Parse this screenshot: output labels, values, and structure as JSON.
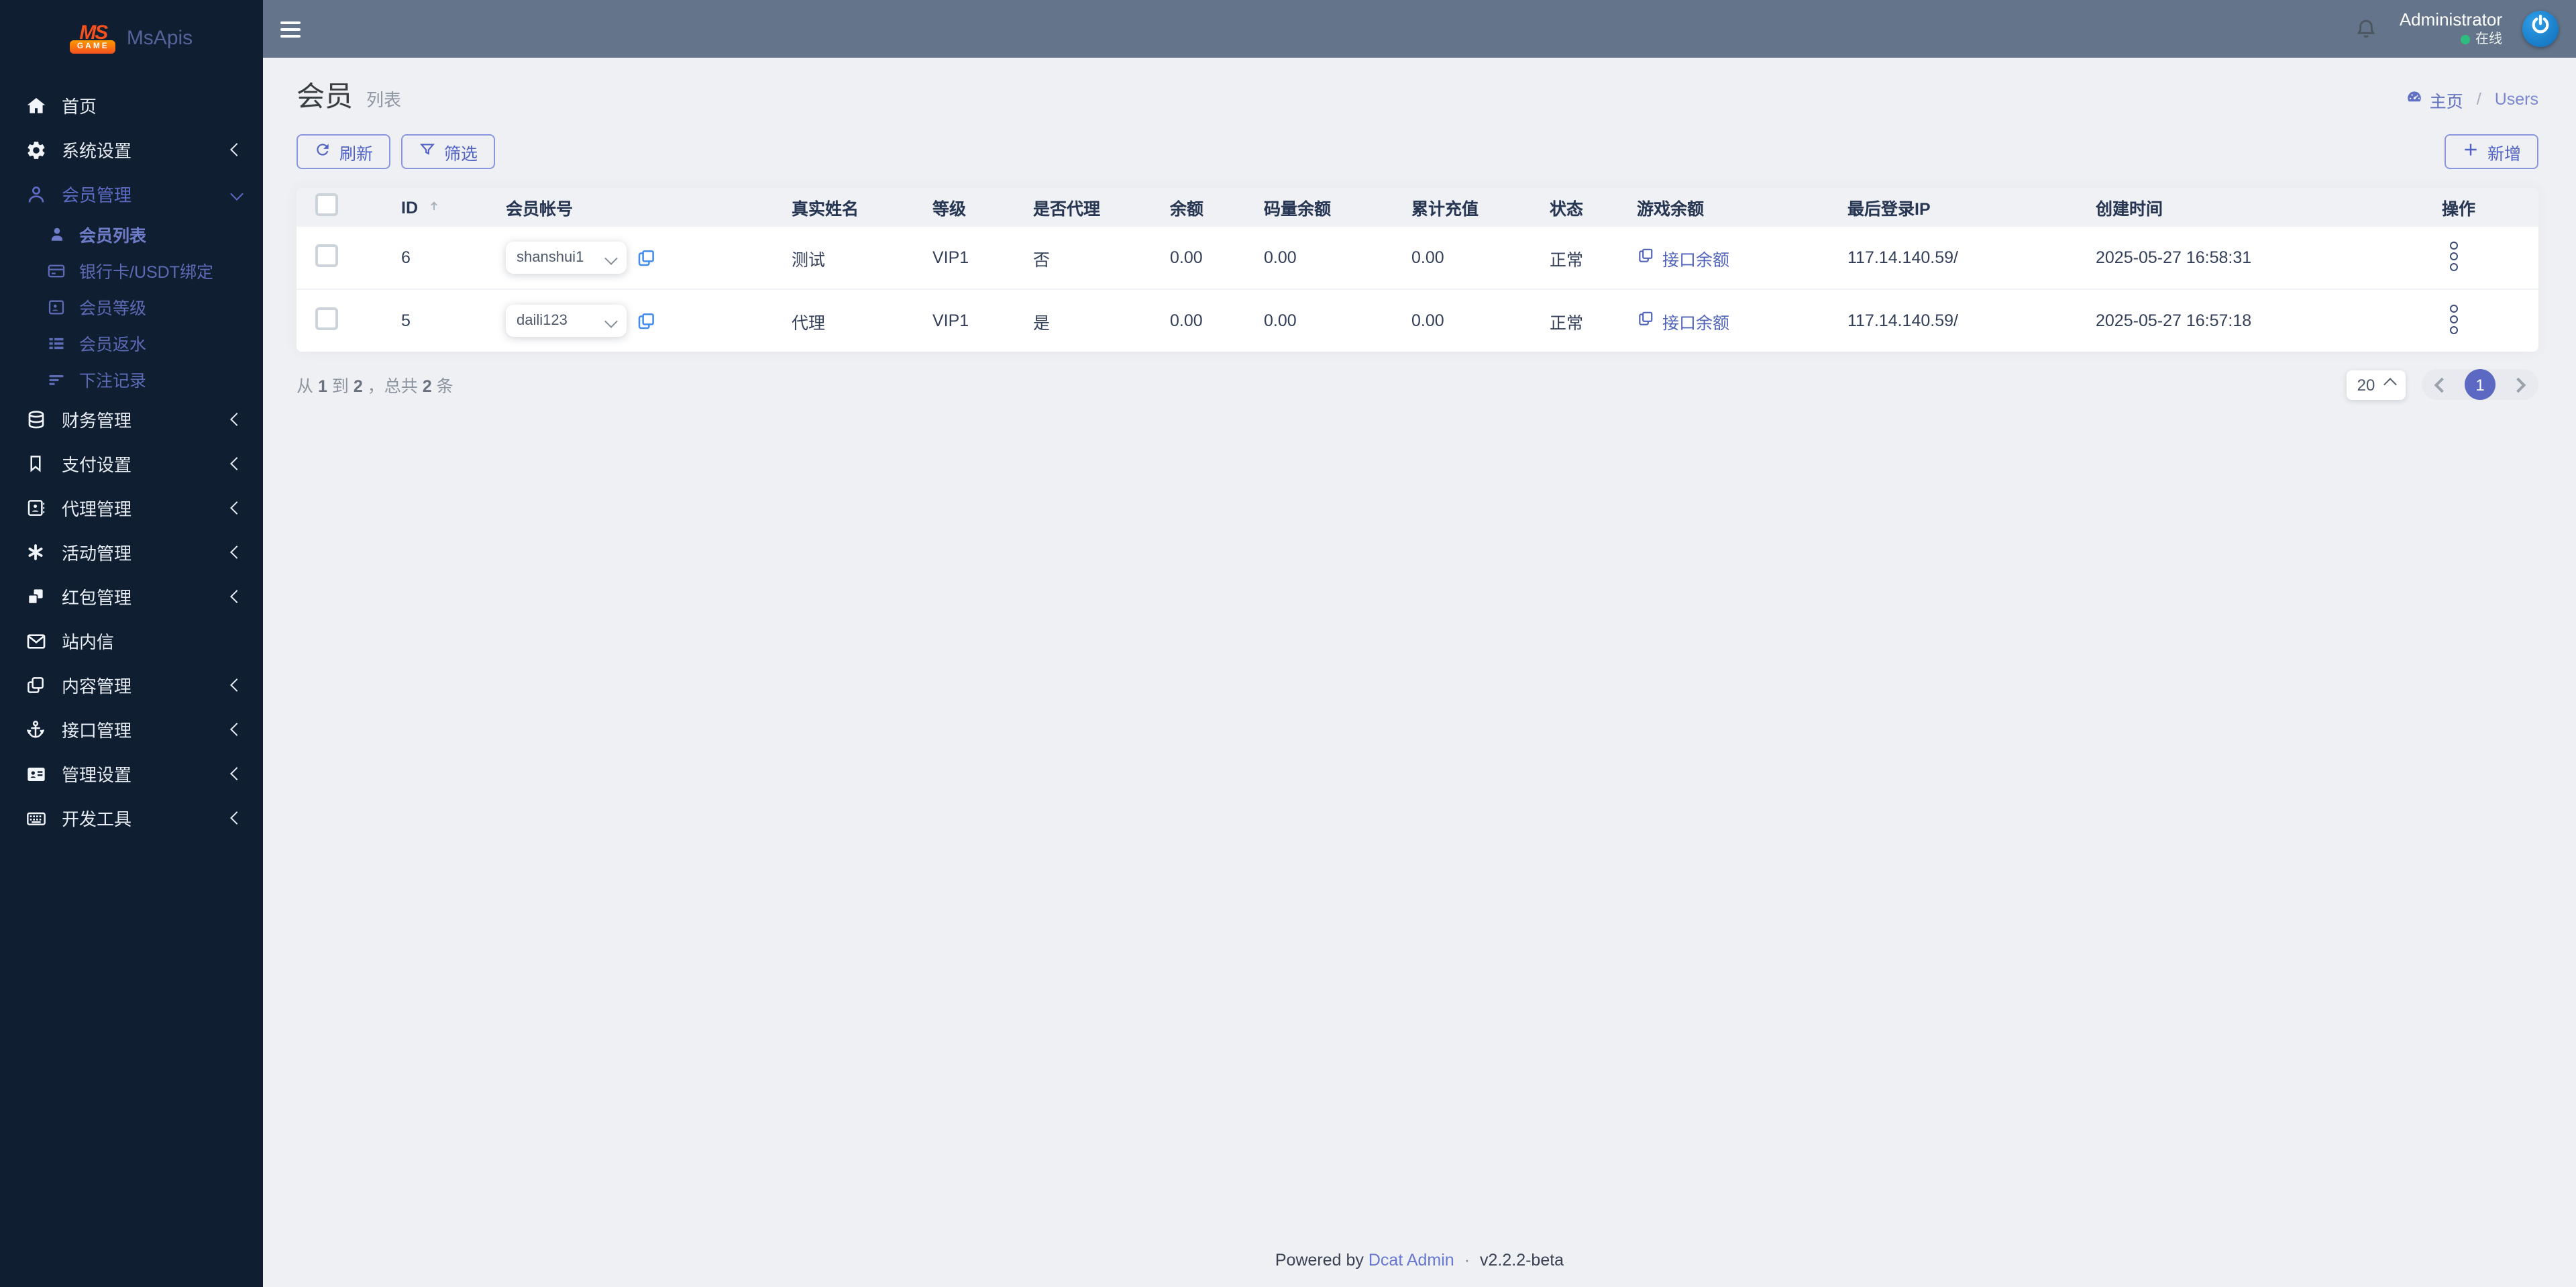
{
  "brand": {
    "logo_ms": "MS",
    "logo_game": "GAME",
    "app_name": "MsApis"
  },
  "header": {
    "admin_name": "Administrator",
    "online_status": "在线",
    "icons": [
      "bell-icon",
      "power-avatar-icon",
      "hamburger-icon"
    ]
  },
  "sidebar": {
    "items": [
      {
        "label": "首页",
        "icon": "home-icon",
        "arrow": null
      },
      {
        "label": "系统设置",
        "icon": "cogs-icon",
        "arrow": "collapsed-left"
      },
      {
        "label": "会员管理",
        "icon": "user-outline-icon",
        "arrow": "expanded-down",
        "active": true
      },
      {
        "label": "会员列表",
        "icon": "user-icon",
        "sub": true,
        "active": true
      },
      {
        "label": "银行卡/USDT绑定",
        "icon": "credit-card-icon",
        "sub": true
      },
      {
        "label": "会员等级",
        "icon": "id-card-icon",
        "sub": true
      },
      {
        "label": "会员返水",
        "icon": "list-icon",
        "sub": true
      },
      {
        "label": "下注记录",
        "icon": "sort-bars-icon",
        "sub": true
      },
      {
        "label": "财务管理",
        "icon": "database-icon",
        "arrow": "collapsed-left"
      },
      {
        "label": "支付设置",
        "icon": "bookmark-icon",
        "arrow": "collapsed-left"
      },
      {
        "label": "代理管理",
        "icon": "address-book-icon",
        "arrow": "collapsed-left"
      },
      {
        "label": "活动管理",
        "icon": "asterisk-icon",
        "arrow": "collapsed-left"
      },
      {
        "label": "红包管理",
        "icon": "boxes-icon",
        "arrow": "collapsed-left"
      },
      {
        "label": "站内信",
        "icon": "envelope-icon",
        "arrow": null
      },
      {
        "label": "内容管理",
        "icon": "clone-icon",
        "arrow": "collapsed-left"
      },
      {
        "label": "接口管理",
        "icon": "anchor-icon",
        "arrow": "collapsed-left"
      },
      {
        "label": "管理设置",
        "icon": "id-badge-icon",
        "arrow": "collapsed-left"
      },
      {
        "label": "开发工具",
        "icon": "keyboard-icon",
        "arrow": "collapsed-left"
      }
    ]
  },
  "page": {
    "title": "会员",
    "subtitle": "列表",
    "breadcrumb": {
      "home": "主页",
      "separator": "/",
      "current": "Users",
      "icon": "gauge-icon"
    }
  },
  "toolbar": {
    "refresh_label": "刷新",
    "filter_label": "筛选",
    "create_label": "新增",
    "icons": [
      "refresh-icon",
      "filter-icon",
      "plus-icon"
    ]
  },
  "table": {
    "columns": [
      "ID",
      "会员帐号",
      "真实姓名",
      "等级",
      "是否代理",
      "余额",
      "码量余额",
      "累计充值",
      "状态",
      "游戏余额",
      "最后登录IP",
      "创建时间",
      "操作"
    ],
    "sort_column": "ID",
    "rows": [
      {
        "id": "6",
        "account": "shanshui1",
        "real_name": "测试",
        "level": "VIP1",
        "is_agent": "否",
        "balance": "0.00",
        "code_balance": "0.00",
        "total_recharge": "0.00",
        "status": "正常",
        "game_balance_label": "接口余额",
        "last_login_ip": "117.14.140.59/",
        "created_at": "2025-05-27 16:58:31"
      },
      {
        "id": "5",
        "account": "daili123",
        "real_name": "代理",
        "level": "VIP1",
        "is_agent": "是",
        "balance": "0.00",
        "code_balance": "0.00",
        "total_recharge": "0.00",
        "status": "正常",
        "game_balance_label": "接口余额",
        "last_login_ip": "117.14.140.59/",
        "created_at": "2025-05-27 16:57:18"
      }
    ]
  },
  "pagination": {
    "summary": {
      "from_label": "从",
      "start": "1",
      "to_label": "到",
      "end": "2",
      "total_label": "，总共",
      "total": "2",
      "unit_label": "条"
    },
    "page_size": "20",
    "current_page": "1"
  },
  "footer": {
    "powered_by": "Powered by",
    "brand_link": "Dcat Admin",
    "separator": "·",
    "version": "v2.2.2-beta"
  },
  "colors": {
    "primary": "#5b69c2",
    "sidebar_bg": "#101e31",
    "topbar_bg": "#64748a",
    "page_bg": "#eef0f4",
    "online_green": "#2dbd7f",
    "avatar_blue": "#1a80d4",
    "copy_blue": "#3f8cee",
    "link_indigo": "#5063bb"
  }
}
